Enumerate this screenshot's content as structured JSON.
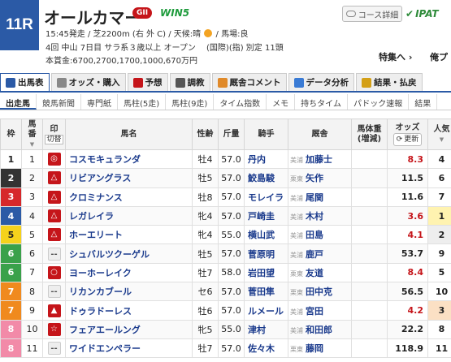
{
  "race": {
    "number": "11R",
    "name": "オールカマー",
    "grade": "GII",
    "win5": "WIN5",
    "info1_a": "15:45発走 / 芝2200m (右 外 C) / 天候:晴",
    "info1_b": "/ 馬場:良",
    "info2": "4回 中山 7日目 サラ系３歳以上 オープン　 (国際)(指) 別定 11頭",
    "info3": "本賞金:6700,2700,1700,1000,670万円"
  },
  "header": {
    "course_label": "コース詳細",
    "ipat_label": "IPAT",
    "tokushu_label": "特集へ ›",
    "ore_label": "俺プ"
  },
  "tabs": [
    {
      "label": "出馬表",
      "icon": "table-icon",
      "color": "#2b5aa6"
    },
    {
      "label": "オッズ・購入",
      "icon": "odds-icon",
      "color": "#888"
    },
    {
      "label": "予想",
      "icon": "target-icon",
      "color": "#c5151a"
    },
    {
      "label": "調教",
      "icon": "clock-icon",
      "color": "#555"
    },
    {
      "label": "厩舎コメント",
      "icon": "person-icon",
      "color": "#e08a2a"
    },
    {
      "label": "データ分析",
      "icon": "chart-icon",
      "color": "#3a7bd5"
    },
    {
      "label": "結果・払戻",
      "icon": "coin-icon",
      "color": "#d4a017"
    }
  ],
  "subtabs": [
    "出走馬",
    "競馬新聞",
    "専門紙",
    "馬柱(5走)",
    "馬柱(9走)",
    "タイム指数",
    "メモ",
    "持ちタイム",
    "パドック速報",
    "結果"
  ],
  "columns": {
    "waku": "枠",
    "umaban": "馬\n番",
    "mark": "印",
    "mark_sub": "切替",
    "name": "馬名",
    "sexage": "性齢",
    "weight": "斤量",
    "jockey": "騎手",
    "trainer": "厩舎",
    "bodyweight": "馬体重",
    "bodyweight_sub": "(増減)",
    "odds": "オッズ",
    "update": "更新",
    "popularity": "人気"
  },
  "horses": [
    {
      "waku": "1",
      "umaban": "1",
      "mark": "◎",
      "name": "コスモキュランダ",
      "sexage": "牡4",
      "weight": "57.0",
      "jockey": "丹内",
      "belong": "美浦",
      "trainer": "加藤士",
      "odds": "8.3",
      "pop": "4",
      "hot": true
    },
    {
      "waku": "2",
      "umaban": "2",
      "mark": "△",
      "name": "リビアングラス",
      "sexage": "牡5",
      "weight": "57.0",
      "jockey": "鮫島駿",
      "belong": "栗東",
      "trainer": "矢作",
      "odds": "11.5",
      "pop": "6",
      "hot": false
    },
    {
      "waku": "3",
      "umaban": "3",
      "mark": "△",
      "name": "クロミナンス",
      "sexage": "牡8",
      "weight": "57.0",
      "jockey": "モレイラ",
      "belong": "美浦",
      "trainer": "尾関",
      "odds": "11.6",
      "pop": "7",
      "hot": false
    },
    {
      "waku": "4",
      "umaban": "4",
      "mark": "△",
      "name": "レガレイラ",
      "sexage": "牝4",
      "weight": "57.0",
      "jockey": "戸崎圭",
      "belong": "美浦",
      "trainer": "木村",
      "odds": "3.6",
      "pop": "1",
      "hot": true
    },
    {
      "waku": "5",
      "umaban": "5",
      "mark": "△",
      "name": "ホーエリート",
      "sexage": "牝4",
      "weight": "55.0",
      "jockey": "横山武",
      "belong": "美浦",
      "trainer": "田島",
      "odds": "4.1",
      "pop": "2",
      "hot": true
    },
    {
      "waku": "6",
      "umaban": "6",
      "mark": "--",
      "name": "シュバルツクーゲル",
      "sexage": "牡5",
      "weight": "57.0",
      "jockey": "菅原明",
      "belong": "美浦",
      "trainer": "鹿戸",
      "odds": "53.7",
      "pop": "9",
      "hot": false
    },
    {
      "waku": "6",
      "umaban": "7",
      "mark": "○",
      "name": "ヨーホーレイク",
      "sexage": "牡7",
      "weight": "58.0",
      "jockey": "岩田望",
      "belong": "栗東",
      "trainer": "友道",
      "odds": "8.4",
      "pop": "5",
      "hot": true
    },
    {
      "waku": "7",
      "umaban": "8",
      "mark": "--",
      "name": "リカンカブール",
      "sexage": "セ6",
      "weight": "57.0",
      "jockey": "菅田隼",
      "belong": "栗東",
      "trainer": "田中克",
      "odds": "56.5",
      "pop": "10",
      "hot": false
    },
    {
      "waku": "7",
      "umaban": "9",
      "mark": "▲",
      "name": "ドゥラドーレス",
      "sexage": "牡6",
      "weight": "57.0",
      "jockey": "ルメール",
      "belong": "美浦",
      "trainer": "宮田",
      "odds": "4.2",
      "pop": "3",
      "hot": true
    },
    {
      "waku": "8",
      "umaban": "10",
      "mark": "☆",
      "name": "フェアエールング",
      "sexage": "牝5",
      "weight": "55.0",
      "jockey": "津村",
      "belong": "美浦",
      "trainer": "和田郎",
      "odds": "22.2",
      "pop": "8",
      "hot": false
    },
    {
      "waku": "8",
      "umaban": "11",
      "mark": "--",
      "name": "ワイドエンペラー",
      "sexage": "牡7",
      "weight": "57.0",
      "jockey": "佐々木",
      "belong": "栗東",
      "trainer": "藤岡",
      "odds": "118.9",
      "pop": "11",
      "hot": false
    }
  ],
  "colors": {
    "waku_1": "#ffffff",
    "waku_2": "#333333",
    "waku_3": "#d6282b",
    "waku_4": "#2b5aa6",
    "waku_5": "#f5d21c",
    "waku_6": "#3aa14a",
    "waku_7": "#f08a1e",
    "waku_8": "#f28aa8",
    "accent": "#2b5aa6",
    "odds_hot": "#c5151a",
    "pop_top": "#fff3b0",
    "pop_second": "#eeeeee",
    "pop_third": "#fbe0c4"
  }
}
